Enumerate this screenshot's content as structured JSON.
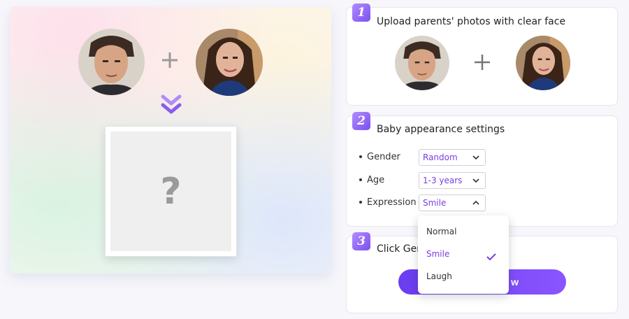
{
  "preview": {
    "plus_glyph": "+",
    "placeholder": "?"
  },
  "step1": {
    "number": "1",
    "title": "Upload parents' photos with clear face",
    "plus_glyph": "+"
  },
  "step2": {
    "number": "2",
    "title": "Baby appearance settings",
    "rows": [
      {
        "label": "Gender",
        "value": "Random"
      },
      {
        "label": "Age",
        "value": "1-3 years"
      },
      {
        "label": "Expression",
        "value": "Smile"
      }
    ]
  },
  "dropdown": {
    "options": [
      "Normal",
      "Smile",
      "Laugh"
    ],
    "selected": "Smile"
  },
  "step3": {
    "number": "3",
    "title": "Click Gen",
    "button_label": "w"
  },
  "colors": {
    "accent": "#7a3de0",
    "button": "#6a3df0",
    "badge": "#9a6cf8"
  }
}
